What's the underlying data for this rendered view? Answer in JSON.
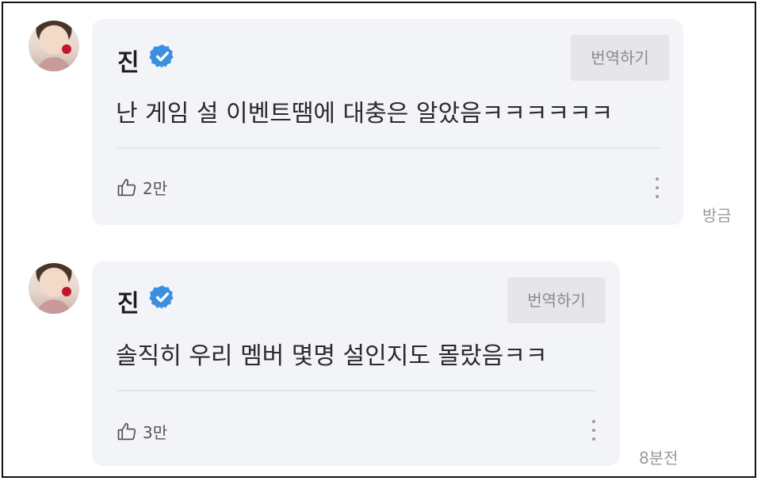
{
  "comments": [
    {
      "author": "진",
      "verified": true,
      "translate_label": "번역하기",
      "text": "난 게임 설 이벤트땜에 대충은 알았음ㅋㅋㅋㅋㅋㅋ",
      "likes": "2만",
      "time": "방금"
    },
    {
      "author": "진",
      "verified": true,
      "translate_label": "번역하기",
      "text": "솔직히 우리 멤버 몇명 설인지도 몰랐음ㅋㅋ",
      "likes": "3만",
      "time": "8분전"
    }
  ],
  "colors": {
    "bubble": "#f3f4f8",
    "verified_badge": "#3b8fe0",
    "text": "#2a2a2a",
    "muted": "#9a9aa0"
  },
  "icons": [
    "verified-badge-icon",
    "thumbs-up-icon",
    "more-vertical-icon"
  ]
}
